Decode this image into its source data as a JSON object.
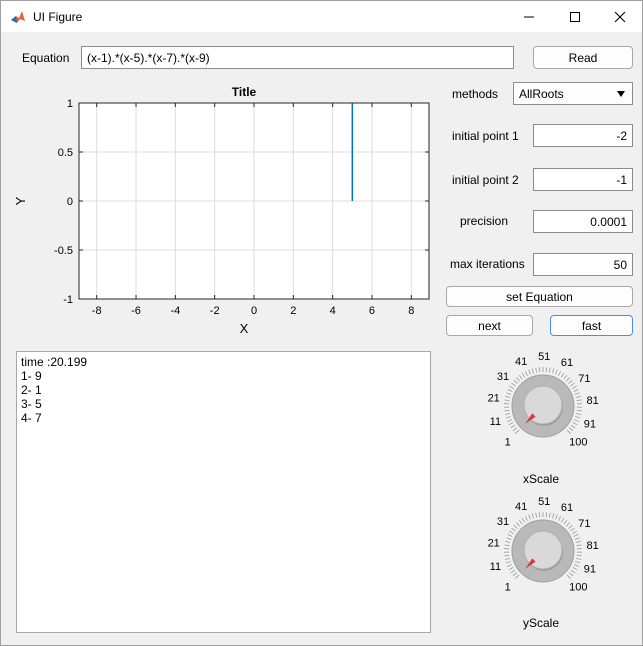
{
  "window": {
    "title": "UI Figure"
  },
  "equation": {
    "label": "Equation",
    "value": "(x-1).*(x-5).*(x-7).*(x-9)",
    "read_button": "Read"
  },
  "axes": {
    "title": "Title",
    "xlabel": "X",
    "ylabel": "Y",
    "xticks": [
      "-8",
      "-6",
      "-4",
      "-2",
      "0",
      "2",
      "4",
      "6",
      "8"
    ],
    "yticks": [
      "1",
      "0.5",
      "0",
      "-0.5",
      "-1"
    ]
  },
  "chart_data": {
    "type": "line",
    "title": "Title",
    "xlabel": "X",
    "ylabel": "Y",
    "xlim": [
      -8.9,
      8.9
    ],
    "ylim": [
      -1,
      1
    ],
    "grid": true,
    "xticks": [
      -8,
      -6,
      -4,
      -2,
      0,
      2,
      4,
      6,
      8
    ],
    "yticks": [
      -1,
      -0.5,
      0,
      0.5,
      1
    ],
    "series": [
      {
        "color": "#0072bd",
        "x": [
          5,
          5
        ],
        "y": [
          0,
          1
        ]
      }
    ]
  },
  "controls": {
    "methods_label": "methods",
    "methods_value": "AllRoots",
    "initial_point_1_label": "initial point 1",
    "initial_point_1_value": "-2",
    "initial_point_2_label": "initial point 2",
    "initial_point_2_value": "-1",
    "precision_label": "precision",
    "precision_value": "0.0001",
    "max_iterations_label": "max iterations",
    "max_iterations_value": "50",
    "set_equation_button": "set Equation",
    "next_button": "next",
    "fast_button": "fast"
  },
  "output": {
    "lines": [
      "time :20.199",
      "1- 9",
      "2- 1",
      "3- 5",
      "4- 7"
    ]
  },
  "knobs": {
    "tick_labels": [
      "1",
      "11",
      "21",
      "31",
      "41",
      "51",
      "61",
      "71",
      "81",
      "91",
      "100"
    ],
    "xscale": {
      "label": "xScale",
      "value": 1
    },
    "yscale": {
      "label": "yScale",
      "value": 1
    }
  }
}
